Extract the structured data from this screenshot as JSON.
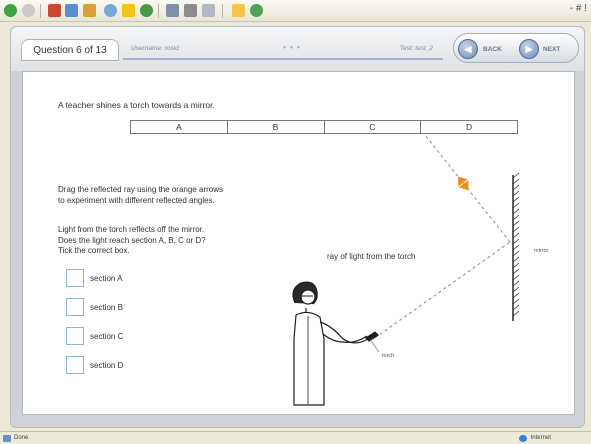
{
  "browser": {
    "toolbar_icons": [
      "back-icon",
      "forward-icon",
      "stop-icon",
      "refresh-icon",
      "home-icon",
      "search-icon",
      "favorites-icon",
      "history-icon",
      "mail-icon",
      "print-icon",
      "edit-icon",
      "folder-icon",
      "messenger-icon"
    ],
    "window_controls": "- # !",
    "status": {
      "left": "Done",
      "right": "Internet"
    }
  },
  "header": {
    "question_label": "Question 6 of 13",
    "username_label": "Username: rosid",
    "separator_dots": "• • •",
    "test_label": "Test: test_2",
    "back_label": "BACK",
    "next_label": "NEXT"
  },
  "question": {
    "intro": "A teacher shines a torch towards a mirror.",
    "sections": [
      "A",
      "B",
      "C",
      "D"
    ],
    "instruction_drag": [
      "Drag the reflected ray using the orange arrows",
      "to experiment with different reflected angles."
    ],
    "instruction_question": [
      "Light from the torch reflects off the mirror.",
      "Does the light reach section A, B, C or D?",
      "Tick the correct box."
    ],
    "options": [
      "section A",
      "section B",
      "section C",
      "section D"
    ],
    "ray_label": "ray of light from the torch",
    "mirror_label": "mirror",
    "torch_label": "torch"
  },
  "colors": {
    "accent_orange": "#f08a1c",
    "checkbox_border": "#8fb6d9",
    "nav_blue": "#6f88b3"
  }
}
